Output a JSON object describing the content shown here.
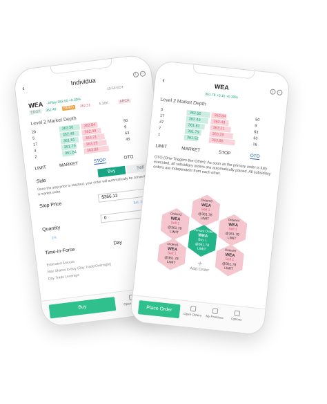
{
  "left_phone": {
    "title": "Individua",
    "time": "19:59 EDT",
    "symbol": "WEA",
    "quote": "APlay 362.50 +0.30%",
    "badge_edgx": "EDGX",
    "badge_arca": "ARCA",
    "badge_n": "NMKO",
    "price_bid": "362.49",
    "price_ask": "362.51",
    "size_a": "3.",
    "size_b": "5.30K",
    "market_depth": "Level 2 Market Depth",
    "depth": [
      {
        "l": "20",
        "bid": "362.50",
        "ask": "362.84",
        "r": "50"
      },
      {
        "l": "5",
        "bid": "362.49",
        "ask": "362.49",
        "r": "9"
      },
      {
        "l": "17",
        "bid": "361.81",
        "ask": "363.21",
        "r": "63"
      },
      {
        "l": "4",
        "bid": "361.79",
        "ask": "363.29",
        "r": "45"
      },
      {
        "l": "2",
        "bid": "361.84",
        "ask": "363.88",
        "r": ""
      }
    ],
    "tabs": [
      "LIMIT",
      "MARKET",
      "STOP",
      "OTO"
    ],
    "side_label": "Side",
    "buy": "Buy",
    "sell": "Sell",
    "stop_note": "Once the stop price is reached, your order will automatically be converted to a market order.",
    "stop_price_label": "Stop Price",
    "stop_price_value": "$366.12",
    "stop_note2": "Est. 3%",
    "quantity_label": "Quantity",
    "quantity_value": "0",
    "quantity_hint": "1%",
    "tif_label": "Time-in-Force",
    "tif_value": "Day",
    "estimated_amount": "Estimated Amount",
    "max_shares": "Max Shares to Buy (Day Trade/Overnight)",
    "day_trade": "Day Trade Leverage",
    "action_btn": "Buy",
    "nav": [
      "Open Orders",
      "My"
    ]
  },
  "right_phone": {
    "symbol": "WEA",
    "quote": "361.78 +0.15 +0.30%",
    "market_depth": "Level 2 Market Depth",
    "depth": [
      {
        "l": "3",
        "bid": "362.50",
        "ask": "362.84",
        "r": "50"
      },
      {
        "l": "17",
        "bid": "362.49",
        "ask": "362.49",
        "r": "9"
      },
      {
        "l": "47",
        "bid": "361.81",
        "ask": "363.21",
        "r": "63"
      },
      {
        "l": "7",
        "bid": "361.79",
        "ask": "363.29",
        "r": "63"
      },
      {
        "l": "1",
        "bid": "361.52",
        "ask": "363.88",
        "r": "16"
      }
    ],
    "tabs": [
      "LIMIT",
      "MARKET",
      "STOP",
      "OTO"
    ],
    "oto_desc": "OTO (One-Triggers-the-Other): As soon as the primary order is fully executed, all subsidiary orders are automatically placed. All subsidiary orders are independent from each other.",
    "orders": [
      {
        "name": "Order#2",
        "sym": "WEA",
        "side": "Sell 1",
        "price": "@361.78",
        "type": "LIMIT"
      },
      {
        "name": "Order#3",
        "sym": "WEA",
        "side": "Sell 1",
        "price": "@361.78",
        "type": "LIMIT"
      },
      {
        "name": "Order#4",
        "sym": "WEA",
        "side": "Sell 1",
        "price": "@361.78",
        "type": "LIMIT"
      },
      {
        "name": "Order#1",
        "sym": "WEA",
        "side": "Sell 1",
        "price": "@361.78",
        "type": "LIMIT"
      },
      {
        "name": "Order#5",
        "sym": "WEA",
        "side": "Sell 1",
        "price": "@361.78",
        "type": "LIMIT"
      }
    ],
    "primary": {
      "name": "Primary Order",
      "sym": "WEA",
      "side": "Buy 1",
      "price": "@361.78",
      "type": "LIMIT"
    },
    "add_order": "Add Order",
    "action_btn": "Place Order",
    "nav": [
      "Open Orders",
      "My Positions",
      "Options"
    ]
  },
  "colors": {
    "accent": "#16a37c",
    "sell": "#e05a6e",
    "link": "#1c5fb8"
  }
}
